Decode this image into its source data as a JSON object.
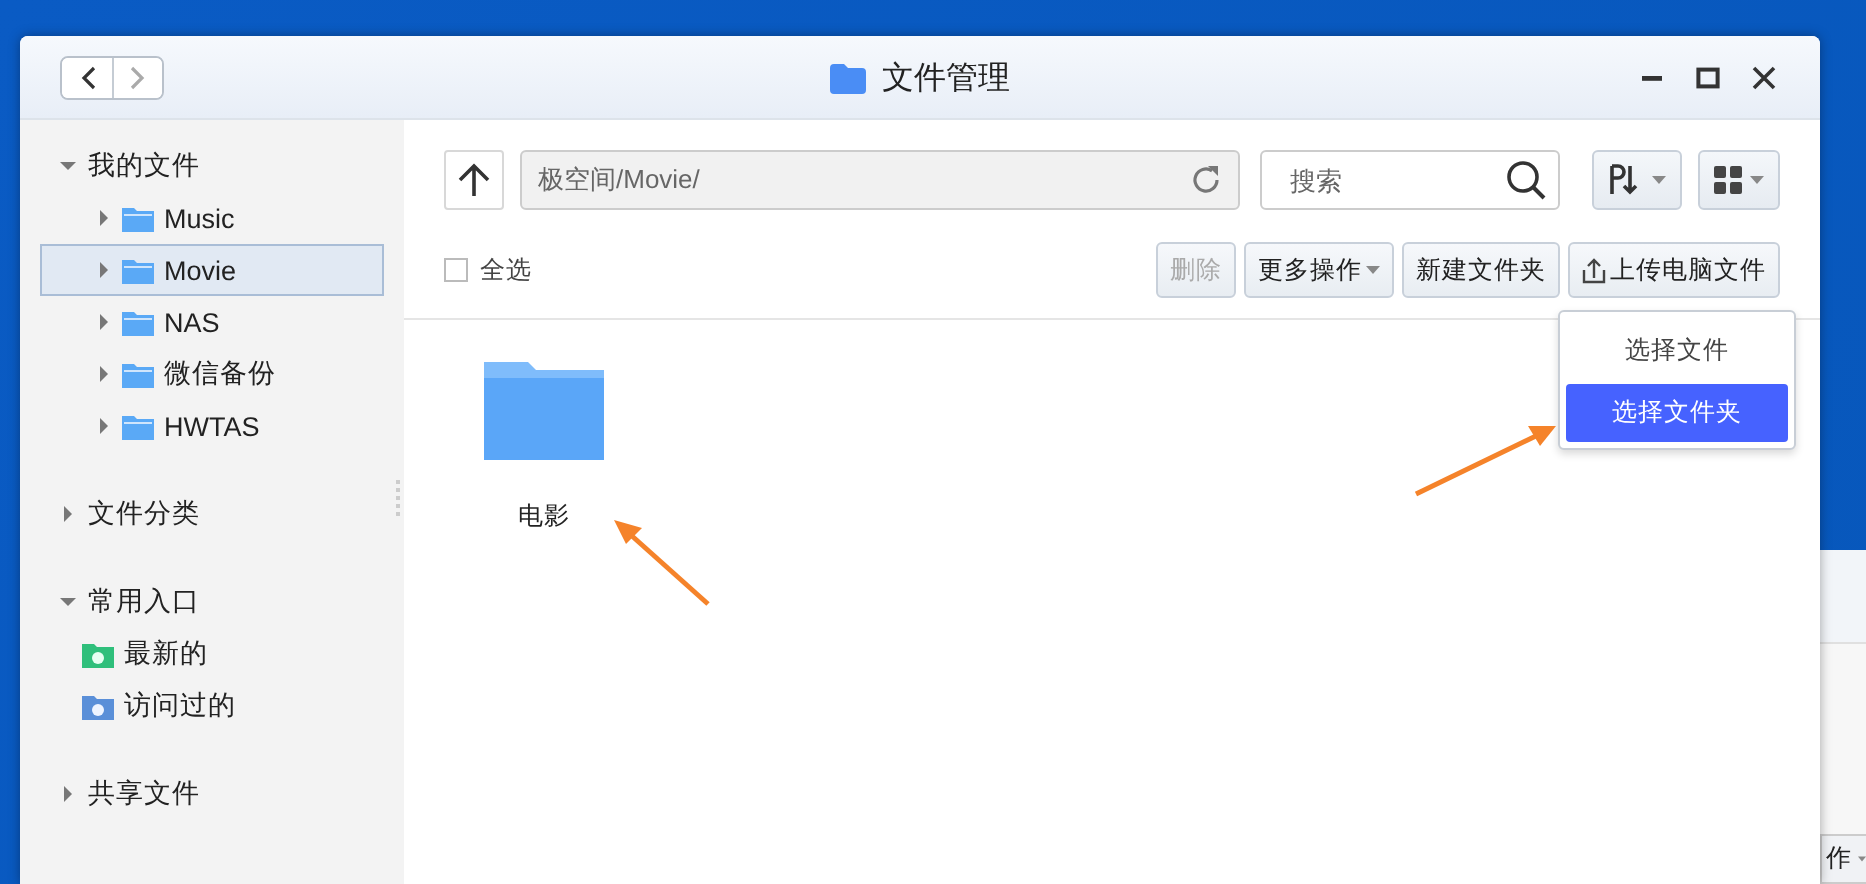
{
  "window": {
    "title": "文件管理"
  },
  "sidebar": {
    "groups": [
      {
        "label": "我的文件",
        "expanded": true,
        "children": [
          {
            "label": "Music",
            "kind": "folder",
            "selected": false
          },
          {
            "label": "Movie",
            "kind": "folder",
            "selected": true
          },
          {
            "label": "NAS",
            "kind": "folder",
            "selected": false
          },
          {
            "label": "微信备份",
            "kind": "folder",
            "selected": false
          },
          {
            "label": "HWTAS",
            "kind": "folder",
            "selected": false
          }
        ]
      },
      {
        "label": "文件分类",
        "expanded": false
      },
      {
        "label": "常用入口",
        "expanded": true,
        "children": [
          {
            "label": "最新的",
            "kind": "recent",
            "selected": false
          },
          {
            "label": "访问过的",
            "kind": "visited",
            "selected": false
          }
        ]
      },
      {
        "label": "共享文件",
        "expanded": false
      }
    ]
  },
  "toolbar": {
    "path": "极空间/Movie/",
    "search": {
      "placeholder": "搜索"
    }
  },
  "select_all": {
    "label": "全选",
    "checked": false
  },
  "actions": [
    {
      "label": "删除",
      "disabled": true,
      "kind": "plain"
    },
    {
      "label": "更多操作",
      "disabled": false,
      "kind": "dropdown"
    },
    {
      "label": "新建文件夹",
      "disabled": false,
      "kind": "plain"
    },
    {
      "label": "上传电脑文件",
      "disabled": false,
      "kind": "upload"
    }
  ],
  "upload_menu": [
    {
      "label": "选择文件",
      "selected": false
    },
    {
      "label": "选择文件夹",
      "selected": true
    }
  ],
  "files": [
    {
      "name": "电影",
      "kind": "folder"
    }
  ],
  "background_window": {
    "button_text": "作"
  }
}
